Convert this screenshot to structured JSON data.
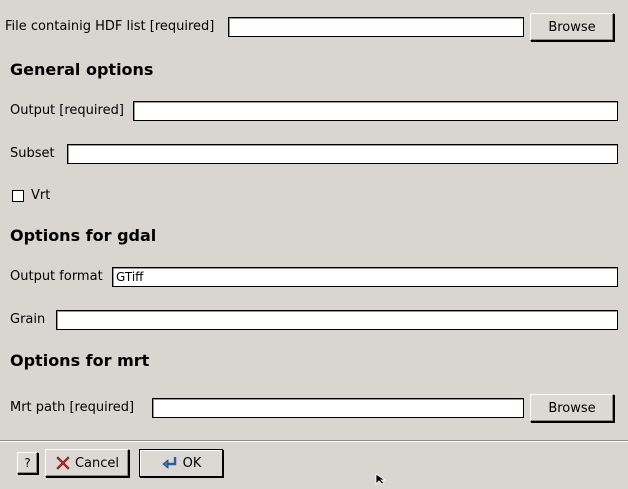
{
  "hdf_list": {
    "label": "File containig HDF list [required]",
    "value": "",
    "browse_label": "Browse"
  },
  "general": {
    "heading": "General options",
    "output_label": "Output [required]",
    "output_value": "",
    "subset_label": "Subset",
    "subset_value": "",
    "vrt_label": "Vrt",
    "vrt_checked": false
  },
  "gdal": {
    "heading": "Options for gdal",
    "format_label": "Output format",
    "format_value": "GTiff",
    "grain_label": "Grain",
    "grain_value": ""
  },
  "mrt": {
    "heading": "Options for mrt",
    "path_label": "Mrt path [required]",
    "path_value": "",
    "browse_label": "Browse"
  },
  "footer": {
    "help_label": "?",
    "cancel_label": "Cancel",
    "ok_label": "OK",
    "cancel_icon": "cancel-x-icon",
    "ok_icon": "enter-arrow-icon"
  }
}
